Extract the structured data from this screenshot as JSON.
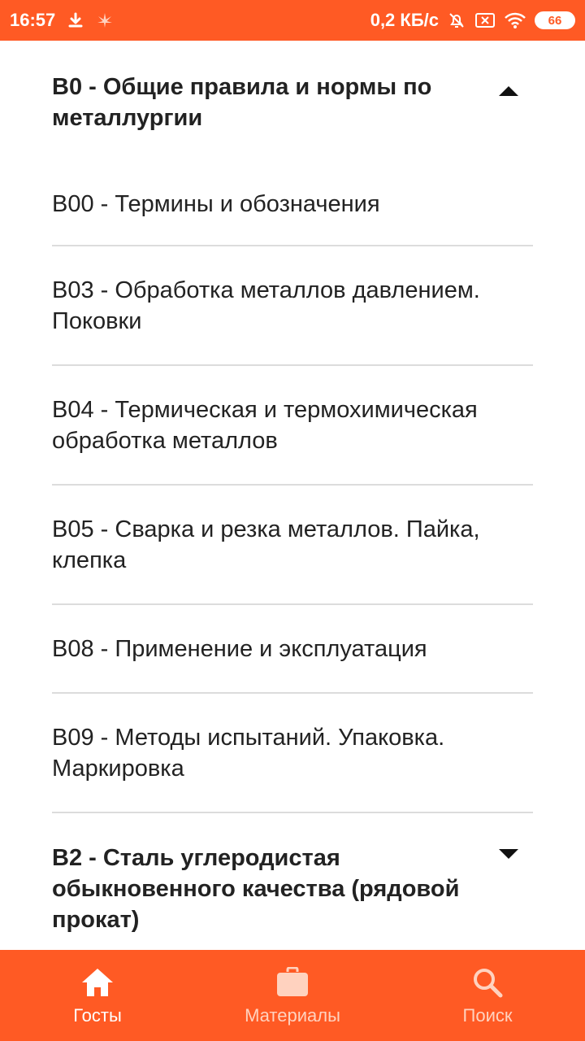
{
  "status_bar": {
    "time": "16:57",
    "network_speed": "0,2 КБ/с",
    "battery": "66",
    "icons": [
      "download-icon",
      "cannabis-icon",
      "alarm-off-icon",
      "sim-x-icon",
      "wifi-icon",
      "battery-icon"
    ]
  },
  "groups": [
    {
      "title": "В0 - Общие правила и нормы по металлургии",
      "expanded": true,
      "items": [
        "В00 - Термины и обозначения",
        "В03 - Обработка металлов давлением. Поковки",
        "В04 - Термическая и термохимическая обработка металлов",
        "В05 - Сварка и резка металлов. Пайка, клепка",
        "В08 - Применение и эксплуатация",
        "В09 - Методы испытаний. Упаковка. Маркировка"
      ]
    },
    {
      "title": "В2 - Сталь углеродистая обыкновенного качества (рядовой прокат)",
      "expanded": false
    }
  ],
  "bottom_nav": [
    {
      "label": "Госты",
      "icon": "home-icon",
      "active": true
    },
    {
      "label": "Материалы",
      "icon": "briefcase-icon",
      "active": false
    },
    {
      "label": "Поиск",
      "icon": "search-icon",
      "active": false
    }
  ],
  "colors": {
    "accent": "#ff5a24",
    "divider": "#dcdcdc",
    "text": "#222222",
    "nav_inactive": "#ffd2bf"
  }
}
